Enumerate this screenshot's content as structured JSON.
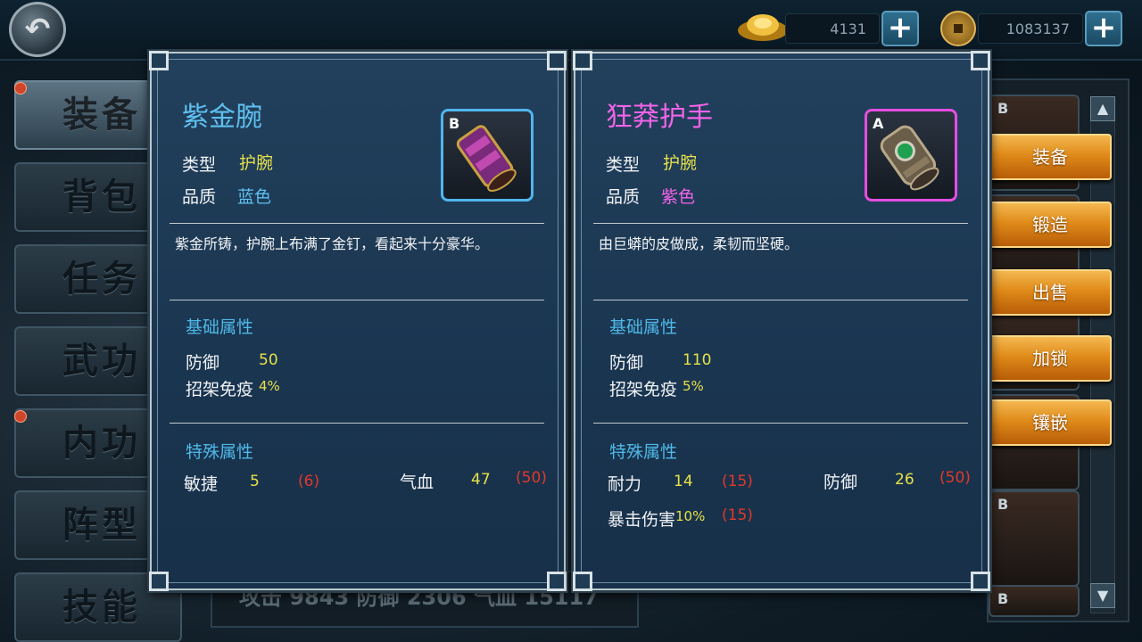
{
  "currency": {
    "ingot_amount": "4131",
    "coin_amount": "1083137"
  },
  "side_tabs": [
    "装备",
    "背包",
    "任务",
    "武功",
    "内功",
    "阵型",
    "技能"
  ],
  "stats_bar": "攻击 9843 防御 2306 气血 15117",
  "inventory": {
    "grades": [
      "B",
      "B",
      "B",
      "B",
      "B",
      "B",
      "B"
    ]
  },
  "actions": [
    "装备",
    "锻造",
    "出售",
    "加锁",
    "镶嵌"
  ],
  "left_card": {
    "name": "紫金腕",
    "grade": "B",
    "type_label": "类型",
    "type_value": "护腕",
    "quality_label": "品质",
    "quality_value": "蓝色",
    "description": "紫金所铸，护腕上布满了金钉，看起来十分豪华。",
    "base_title": "基础属性",
    "base": [
      {
        "label": "防御",
        "value": "50"
      },
      {
        "label": "招架免疫",
        "value": "4%"
      }
    ],
    "special_title": "特殊属性",
    "special": [
      {
        "label": "敏捷",
        "value": "5",
        "max": "(6)"
      },
      {
        "label": "气血",
        "value": "47",
        "max": "(50)"
      }
    ],
    "name_color": "#5fc0f0",
    "border_color": "#4fb5ee"
  },
  "right_card": {
    "name": "狂莽护手",
    "grade": "A",
    "type_label": "类型",
    "type_value": "护腕",
    "quality_label": "品质",
    "quality_value": "紫色",
    "description": "由巨蟒的皮做成，柔韧而坚硬。",
    "base_title": "基础属性",
    "base": [
      {
        "label": "防御",
        "value": "110"
      },
      {
        "label": "招架免疫",
        "value": "5%"
      }
    ],
    "special_title": "特殊属性",
    "special": [
      {
        "label": "耐力",
        "value": "14",
        "max": "(15)"
      },
      {
        "label": "防御",
        "value": "26",
        "max": "(50)"
      },
      {
        "label": "暴击伤害",
        "value": "10%",
        "max": "(15)"
      }
    ],
    "name_color": "#f264e8",
    "border_color": "#e44ee0"
  }
}
